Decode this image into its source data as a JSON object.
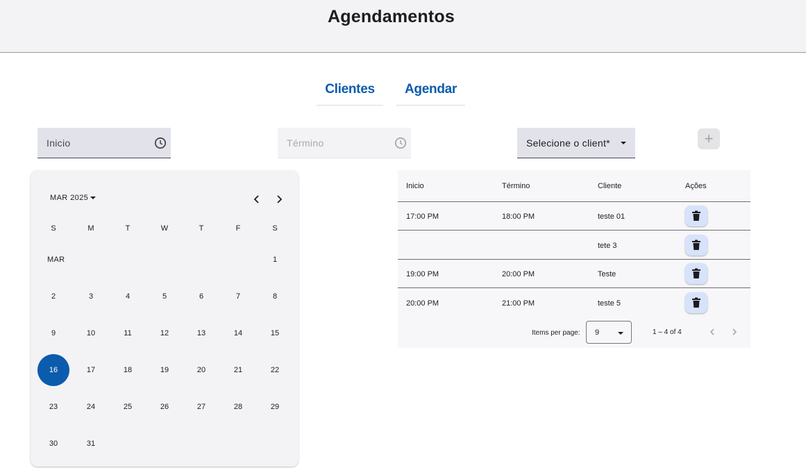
{
  "header": {
    "title": "Agendamentos"
  },
  "nav": {
    "clientes": "Clientes",
    "agendar": "Agendar"
  },
  "form": {
    "inicio_label": "Inicio",
    "termino_label": "Término",
    "cliente_label": "Selecione o client*",
    "add_symbol": "+"
  },
  "calendar": {
    "period": "MAR 2025",
    "month_label": "MAR",
    "weekdays": [
      "S",
      "M",
      "T",
      "W",
      "T",
      "F",
      "S"
    ],
    "selected_day": "16",
    "days": [
      "1",
      "2",
      "3",
      "4",
      "5",
      "6",
      "7",
      "8",
      "9",
      "10",
      "11",
      "12",
      "13",
      "14",
      "15",
      "16",
      "17",
      "18",
      "19",
      "20",
      "21",
      "22",
      "23",
      "24",
      "25",
      "26",
      "27",
      "28",
      "29",
      "30",
      "31"
    ]
  },
  "table": {
    "headers": [
      "Inicio",
      "Término",
      "Cliente",
      "Ações"
    ],
    "rows": [
      [
        "17:00 PM",
        "18:00 PM",
        "teste 01"
      ],
      [
        "",
        "",
        "tete 3"
      ],
      [
        "19:00 PM",
        "20:00 PM",
        "Teste"
      ],
      [
        "20:00 PM",
        "21:00 PM",
        "teste 5"
      ]
    ],
    "paginator": {
      "items_per_page_label": "Items per page:",
      "page_size": "9",
      "range": "1 – 4 of 4"
    }
  },
  "colors": {
    "primary": "#0b5cad",
    "delete_button_bg": "#d6e3fb"
  },
  "icons": [
    "clock-icon",
    "chevron-left-icon",
    "chevron-right-icon",
    "trash-icon",
    "plus-icon",
    "caret-down-icon"
  ]
}
